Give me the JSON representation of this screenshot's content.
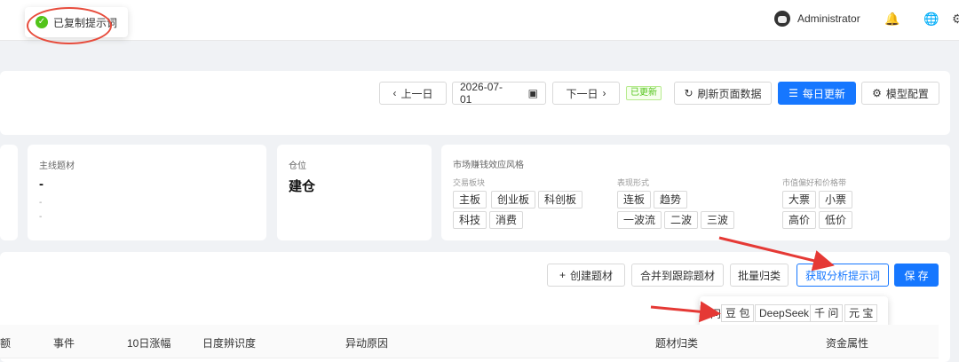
{
  "toast": {
    "message": "已复制提示词"
  },
  "header": {
    "username": "Administrator",
    "bell_icon": "🔔",
    "globe_icon": "🌐",
    "gear_icon": "⚙"
  },
  "date_bar": {
    "prev_label": "上一日",
    "date_value": "2026-07-01",
    "next_label": "下一日",
    "updated_badge": "已更新",
    "refresh_label": "刷新页面数据",
    "daily_update_label": "每日更新",
    "model_config_label": "模型配置"
  },
  "stats": {
    "theme": {
      "label": "主线题材",
      "value": "-",
      "sub1": "-",
      "sub2": "-"
    },
    "position": {
      "label": "仓位",
      "value": "建仓"
    }
  },
  "style": {
    "title": "市场赚钱效应风格",
    "board_label": "交易板块",
    "board_tags": [
      "主板",
      "创业板",
      "科创板",
      "科技",
      "消费"
    ],
    "form_label": "表现形式",
    "form_tags": [
      "连板",
      "趋势",
      "一波流",
      "二波",
      "三波"
    ],
    "cap_label": "市值偏好和价格带",
    "cap_tags": [
      "大票",
      "小票",
      "高价",
      "低价"
    ]
  },
  "toolbar": {
    "create_label": "创建题材",
    "merge_label": "合并到跟踪题材",
    "batch_label": "批量归类",
    "prompt_label": "获取分析提示词",
    "save_label": "保 存"
  },
  "prompt_menu": {
    "items": [
      "问",
      "豆 包",
      "DeepSeek",
      "千 问",
      "元 宝"
    ]
  },
  "table": {
    "headers": [
      "额",
      "事件",
      "10日涨幅",
      "日度辨识度",
      "异动原因",
      "题材归类",
      "资金属性"
    ]
  }
}
